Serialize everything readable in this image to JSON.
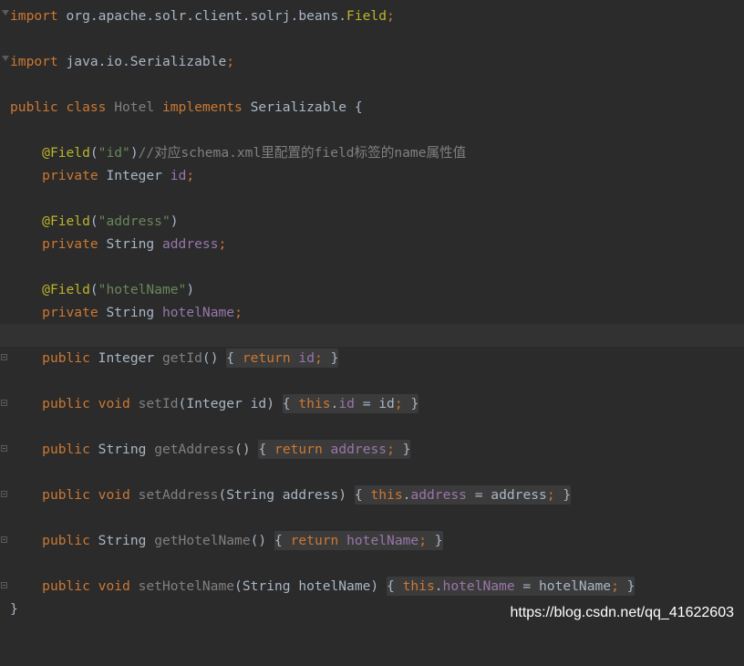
{
  "lines": [
    {
      "text": "import org.apache.solr.client.solrj.beans.Field;"
    },
    {
      "text": ""
    },
    {
      "text": "import java.io.Serializable;"
    },
    {
      "text": ""
    },
    {
      "text": "public class Hotel implements Serializable {"
    },
    {
      "text": ""
    },
    {
      "text": "    @Field(\"id\")//对应schema.xml里配置的field标签的name属性值"
    },
    {
      "text": "    private Integer id;"
    },
    {
      "text": ""
    },
    {
      "text": "    @Field(\"address\")"
    },
    {
      "text": "    private String address;"
    },
    {
      "text": ""
    },
    {
      "text": "    @Field(\"hotelName\")"
    },
    {
      "text": "    private String hotelName;"
    },
    {
      "text": ""
    },
    {
      "text": "    public Integer getId() { return id; }"
    },
    {
      "text": ""
    },
    {
      "text": "    public void setId(Integer id) { this.id = id; }"
    },
    {
      "text": ""
    },
    {
      "text": "    public String getAddress() { return address; }"
    },
    {
      "text": ""
    },
    {
      "text": "    public void setAddress(String address) { this.address = address; }"
    },
    {
      "text": ""
    },
    {
      "text": "    public String getHotelName() { return hotelName; }"
    },
    {
      "text": ""
    },
    {
      "text": "    public void setHotelName(String hotelName) { this.hotelName = hotelName; }"
    },
    {
      "text": "}"
    }
  ],
  "tokens": {
    "import1": [
      "import",
      "org.apache.solr.client.solrj.beans.",
      "Field",
      ";"
    ],
    "import2": [
      "import",
      "java.io.Serializable",
      ";"
    ],
    "classdecl": [
      "public class",
      "Hotel",
      "implements",
      "Serializable {"
    ],
    "ann1": [
      "@Field",
      "(",
      "\"id\"",
      ")",
      "//对应schema.xml里配置的field标签的name属性值"
    ],
    "f1": [
      "private",
      "Integer",
      "id",
      ";"
    ],
    "ann2": [
      "@Field",
      "(",
      "\"address\"",
      ")"
    ],
    "f2": [
      "private",
      "String",
      "address",
      ";"
    ],
    "ann3": [
      "@Field",
      "(",
      "\"hotelName\"",
      ")"
    ],
    "f3": [
      "private",
      "String",
      "hotelName",
      ";"
    ],
    "m1": [
      "public",
      "Integer",
      "getId",
      "()",
      "{",
      "return",
      "id",
      ";",
      "}"
    ],
    "m2": [
      "public void",
      "setId",
      "(Integer id)",
      "{",
      "this",
      ".",
      "id",
      "= id",
      ";",
      "}"
    ],
    "m3": [
      "public",
      "String",
      "getAddress",
      "()",
      "{",
      "return",
      "address",
      ";",
      "}"
    ],
    "m4": [
      "public void",
      "setAddress",
      "(String address)",
      "{",
      "this",
      ".",
      "address",
      "= address",
      ";",
      "}"
    ],
    "m5": [
      "public",
      "String",
      "getHotelName",
      "()",
      "{",
      "return",
      "hotelName",
      ";",
      "}"
    ],
    "m6": [
      "public void",
      "setHotelName",
      "(String hotelName)",
      "{",
      "this",
      ".",
      "hotelName",
      "= hotelName",
      ";",
      "}"
    ],
    "close": [
      "}"
    ]
  },
  "watermark": "https://blog.csdn.net/qq_41622603",
  "colors": {
    "background": "#2b2b2b",
    "keyword": "#cc7832",
    "annotation": "#bbb529",
    "string": "#6a8759",
    "comment": "#808080",
    "field": "#9876aa",
    "plain": "#a9b7c6",
    "current_line": "#323232"
  }
}
